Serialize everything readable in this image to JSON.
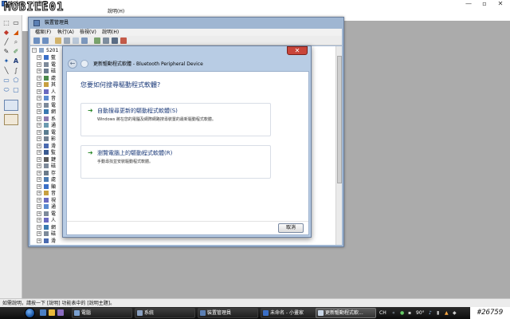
{
  "paint": {
    "title": "未命名 - 小畫家",
    "menu": [
      "說明(H)"
    ],
    "watermark": "MOBILE01",
    "status": "如需說明，請按一下 [說明] 功能表中的 [說明主題]。"
  },
  "device_manager": {
    "title": "裝置管理員",
    "menu": [
      "檔案(F)",
      "執行(A)",
      "檢視(V)",
      "說明(H)"
    ],
    "tree_root": "5201",
    "tree_items": [
      "藍",
      "電",
      "磁",
      "處",
      "其",
      "人",
      "音",
      "電",
      "網",
      "系",
      "通",
      "電",
      "影",
      "滑",
      "監",
      "鍵",
      "磁",
      "存",
      "處",
      "顯",
      "音",
      "視",
      "通",
      "電",
      "人",
      "網",
      "磁",
      "滑"
    ]
  },
  "wizard": {
    "title": "更新驅動程式軟體 - Bluetooth Peripheral Device",
    "question": "您要如何搜尋驅動程式軟體?",
    "option1_title": "自動搜尋更新的驅動程式軟體(S)",
    "option1_desc": "Windows 將在您的電腦及網際網路搜尋裝置的最新驅動程式軟體。",
    "option2_title": "瀏覽電腦上的驅動程式軟體(R)",
    "option2_desc": "手動尋找並安裝驅動程式軟體。",
    "cancel_label": "取消",
    "close_glyph": "✕"
  },
  "taskbar": {
    "tasks": [
      "電腦",
      "系統",
      "裝置管理員",
      "未命名 - 小畫家",
      "更新驅動程式軟..."
    ],
    "tray_lang": "CH",
    "tray_temp": "90°"
  },
  "post_id": "#26759",
  "icons": {
    "back": "back-arrow-icon",
    "option_arrow": "green-arrow-icon"
  }
}
